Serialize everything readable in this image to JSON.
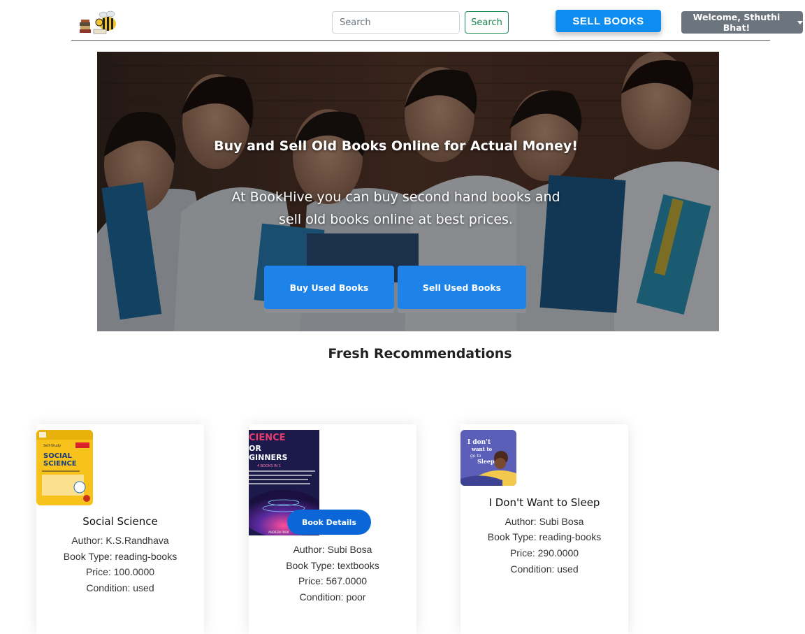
{
  "navbar": {
    "search_placeholder": "Search",
    "search_button": "Search",
    "sell_books": "SELL BOOKS",
    "welcome": "Welcome, Sthuthi Bhat!"
  },
  "hero": {
    "title": "Buy and Sell Old Books Online for Actual Money!",
    "subtitle": "At BookHive you can buy second hand books and sell old books online at best prices.",
    "buy_button": "Buy Used Books",
    "sell_button": "Sell Used Books"
  },
  "recommendations": {
    "title": "Fresh Recommendations",
    "books": [
      {
        "title": "Social Science",
        "author": "Author: K.S.Randhava",
        "type": "Book Type: reading-books",
        "price": "Price: 100.0000",
        "condition": "Condition: used",
        "cover_text": [
          "Self-Study",
          "SOCIAL",
          "SCIENCE"
        ]
      },
      {
        "title": "",
        "author": "Author: Subi Bosa",
        "type": "Book Type: textbooks",
        "price": "Price: 567.0000",
        "condition": "Condition: poor",
        "cover_text": [
          "CIENCE",
          "OR",
          "GINNERS",
          "4 BOOKS IN 1",
          "ANDREW PARK"
        ],
        "details_button": "Book Details"
      },
      {
        "title": "I Don't Want to Sleep",
        "author": "Author: Subi Bosa",
        "type": "Book Type: reading-books",
        "price": "Price: 290.0000",
        "condition": "Condition: used",
        "cover_text": [
          "I don't",
          "want to",
          "go to",
          "Sleep!"
        ]
      }
    ]
  },
  "colors": {
    "primary": "#1e83e8",
    "sell_top": "#0d8df0",
    "success": "#198754",
    "secondary": "#6c757d",
    "details": "#0b66d8"
  }
}
